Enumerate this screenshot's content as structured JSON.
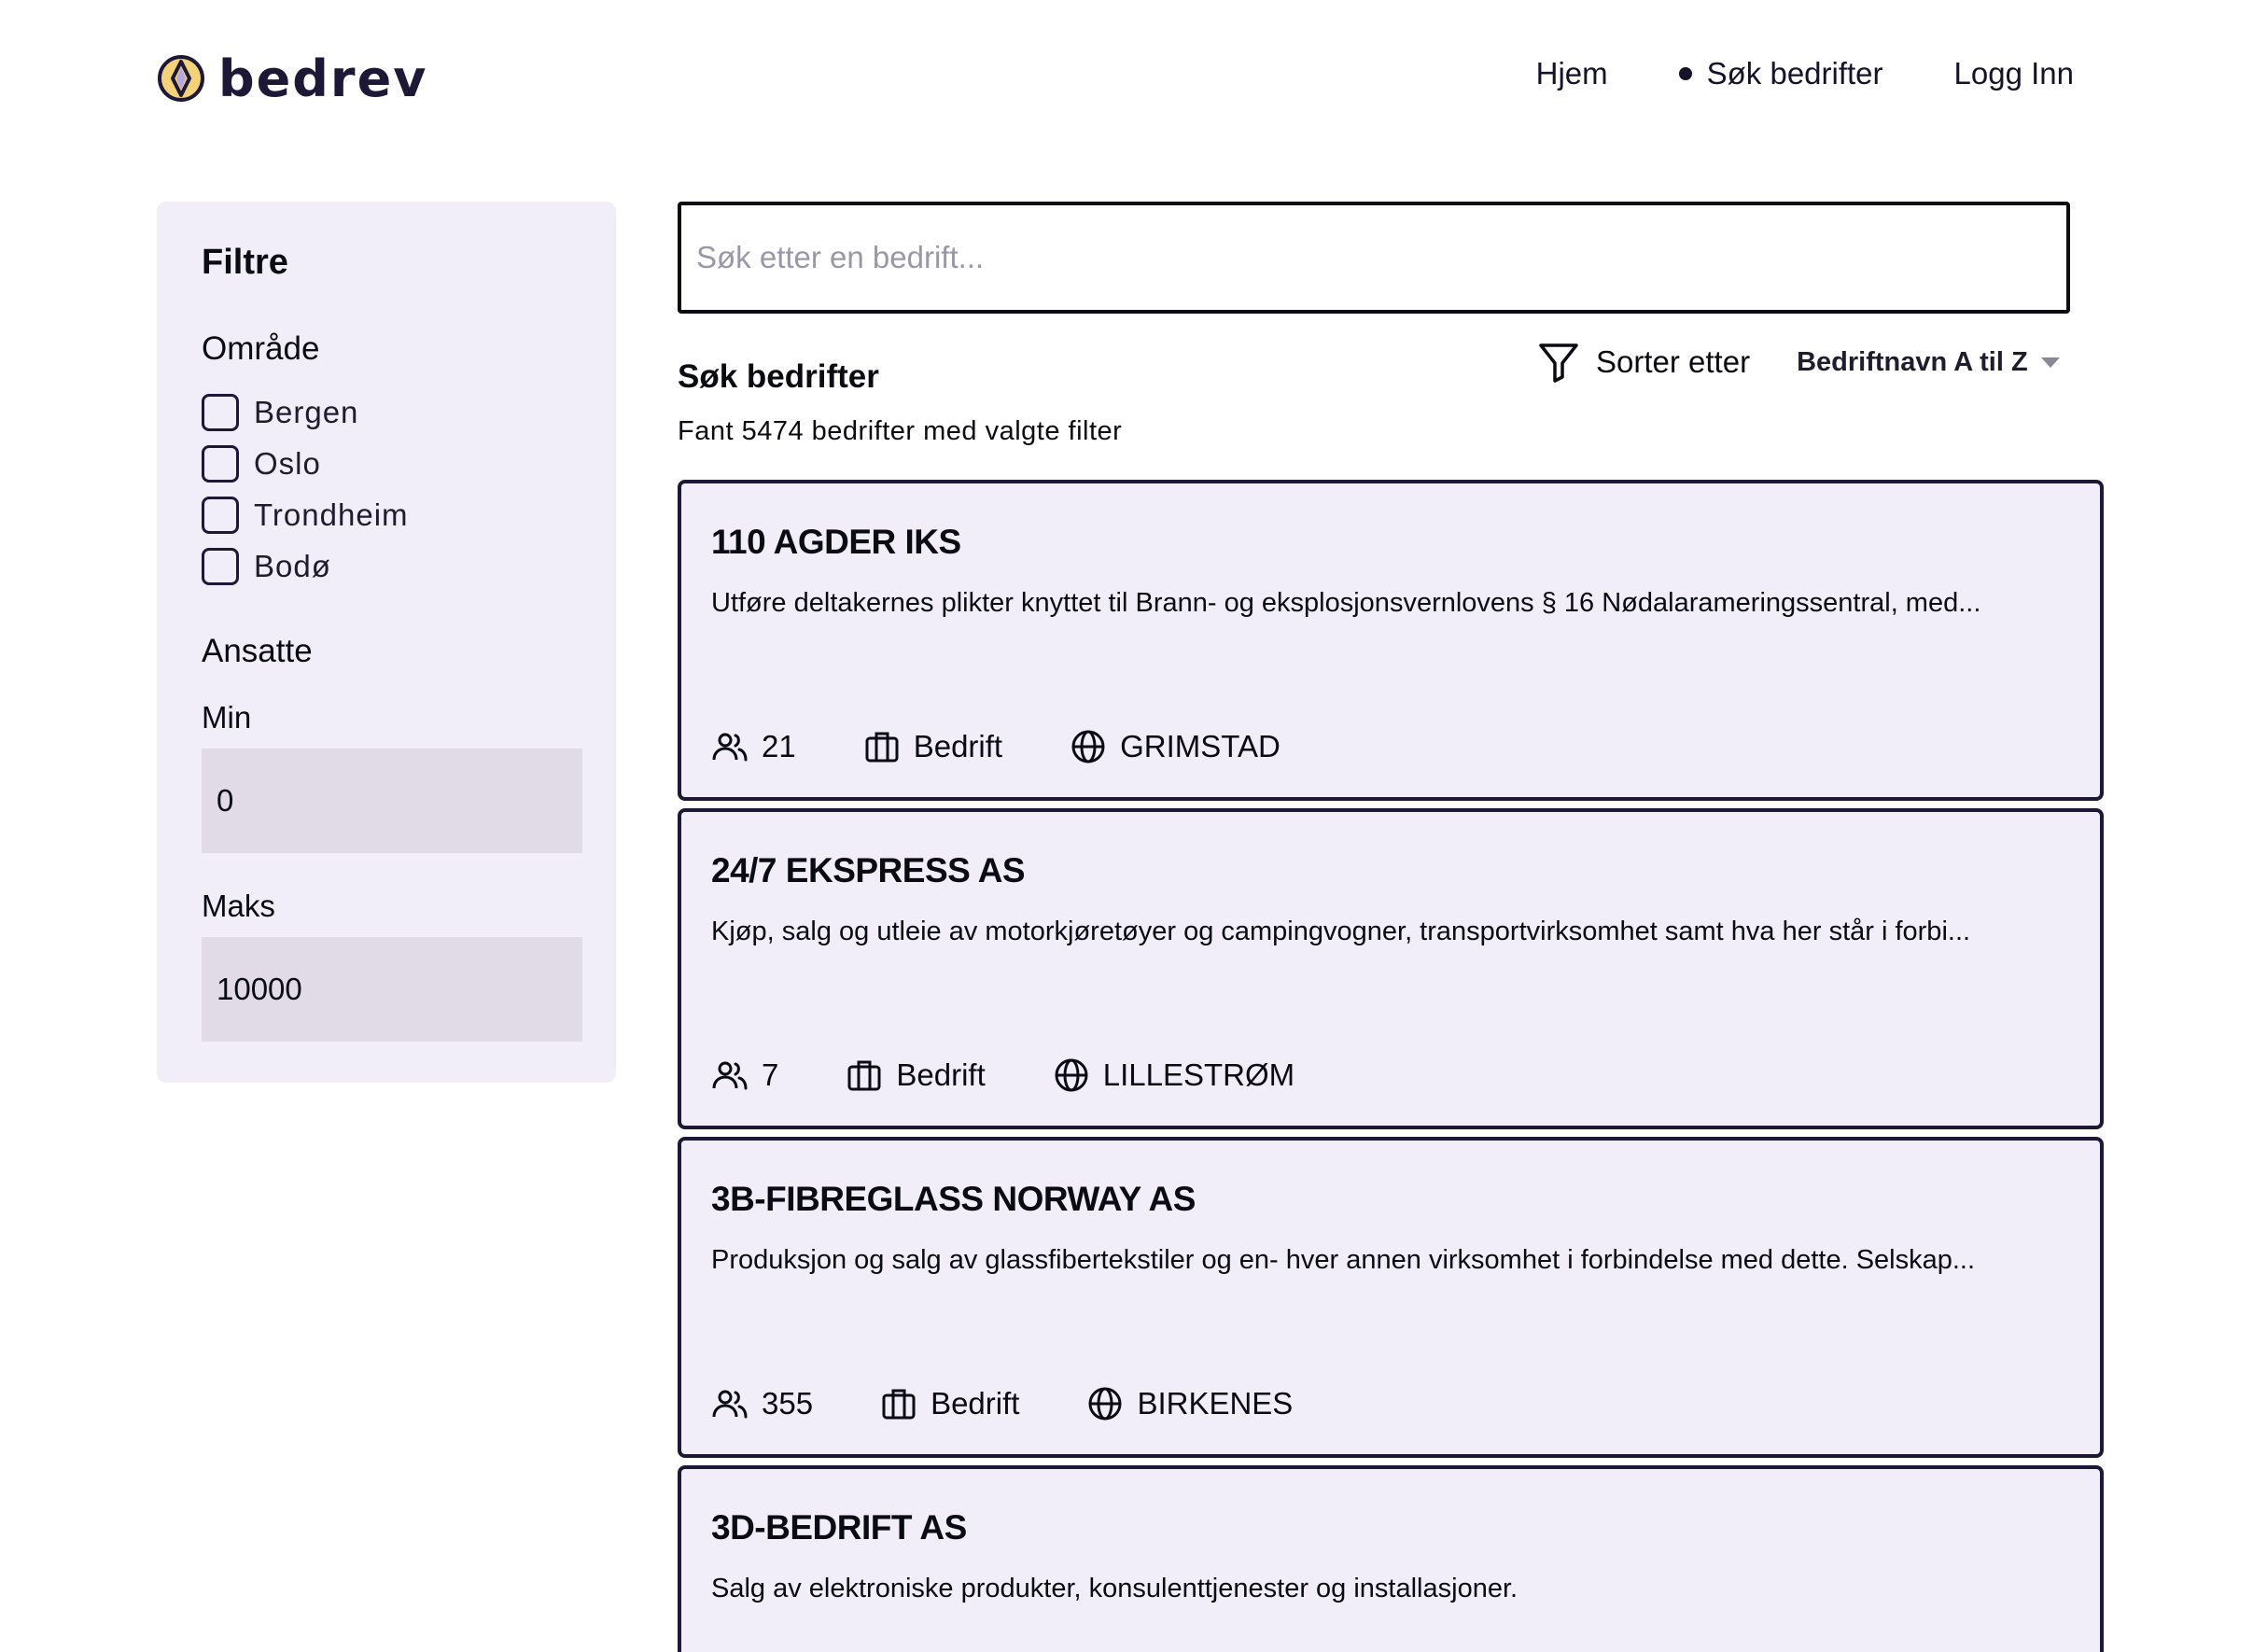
{
  "brand": {
    "name": "bedrev"
  },
  "nav": {
    "home": "Hjem",
    "search": "Søk bedrifter",
    "login": "Logg Inn"
  },
  "filters": {
    "title": "Filtre",
    "area": {
      "title": "Område",
      "options": [
        {
          "label": "Bergen",
          "checked": false
        },
        {
          "label": "Oslo",
          "checked": false
        },
        {
          "label": "Trondheim",
          "checked": false
        },
        {
          "label": "Bodø",
          "checked": false
        }
      ]
    },
    "employees": {
      "title": "Ansatte",
      "min_label": "Min",
      "min_value": "0",
      "max_label": "Maks",
      "max_value": "10000"
    }
  },
  "search": {
    "placeholder": "Søk etter en bedrift...",
    "value": ""
  },
  "results": {
    "title": "Søk bedrifter",
    "count_text": "Fant 5474 bedrifter med valgte filter",
    "sort_label": "Sorter etter",
    "sort_value": "Bedriftnavn A til Z"
  },
  "companies": [
    {
      "name": "110 AGDER IKS",
      "description": "Utføre deltakernes plikter knyttet til Brann- og eksplosjonsvernlovens § 16 Nødalarameringssentral, med...",
      "employees": "21",
      "type": "Bedrift",
      "location": "GRIMSTAD"
    },
    {
      "name": "24/7 EKSPRESS AS",
      "description": "Kjøp, salg og utleie av motorkjøretøyer og campingvogner, transportvirksomhet samt hva her står i forbi...",
      "employees": "7",
      "type": "Bedrift",
      "location": "LILLESTRØM"
    },
    {
      "name": "3B-FIBREGLASS NORWAY AS",
      "description": "Produksjon og salg av glassfibertekstiler og en- hver annen virksomhet i forbindelse med dette. Selskap...",
      "employees": "355",
      "type": "Bedrift",
      "location": "BIRKENES"
    },
    {
      "name": "3D-BEDRIFT AS",
      "description": "Salg av elektroniske produkter, konsulenttjenester og installasjoner.",
      "employees": "",
      "type": "",
      "location": ""
    }
  ],
  "icons": {
    "logo": "bedrev-logo-icon",
    "nav_dot": "active-dot-icon",
    "filter": "filter-funnel-icon",
    "caret": "chevron-down-icon",
    "employees": "people-icon",
    "type": "briefcase-icon",
    "location": "globe-icon"
  },
  "colors": {
    "panel_bg": "#f1eefa",
    "input_bg": "#e1dbe8",
    "border": "#1c1836",
    "logo_yellow": "#f4d27a"
  }
}
